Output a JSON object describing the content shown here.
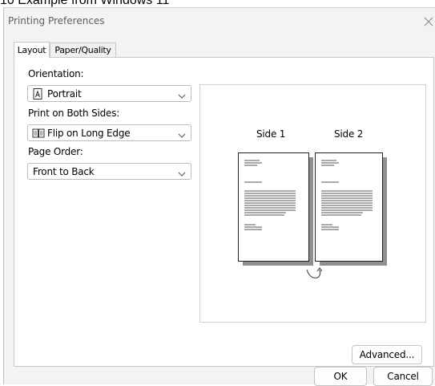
{
  "caption": "10 Example from Windows 11",
  "window": {
    "title": "Printing Preferences",
    "close_icon": "close-icon"
  },
  "tabs": [
    {
      "label": "Layout",
      "active": true
    },
    {
      "label": "Paper/Quality",
      "active": false
    }
  ],
  "layout": {
    "orientation": {
      "label": "Orientation:",
      "value": "Portrait",
      "icon": "portrait-page-icon"
    },
    "duplex": {
      "label": "Print on Both Sides:",
      "value": "Flip on Long Edge",
      "icon": "flip-long-edge-icon"
    },
    "page_order": {
      "label": "Page Order:",
      "value": "Front to Back"
    }
  },
  "preview": {
    "side1_label": "Side 1",
    "side2_label": "Side 2",
    "flip_icon": "flip-arrow-icon"
  },
  "buttons": {
    "advanced": "Advanced...",
    "ok": "OK",
    "cancel": "Cancel"
  }
}
